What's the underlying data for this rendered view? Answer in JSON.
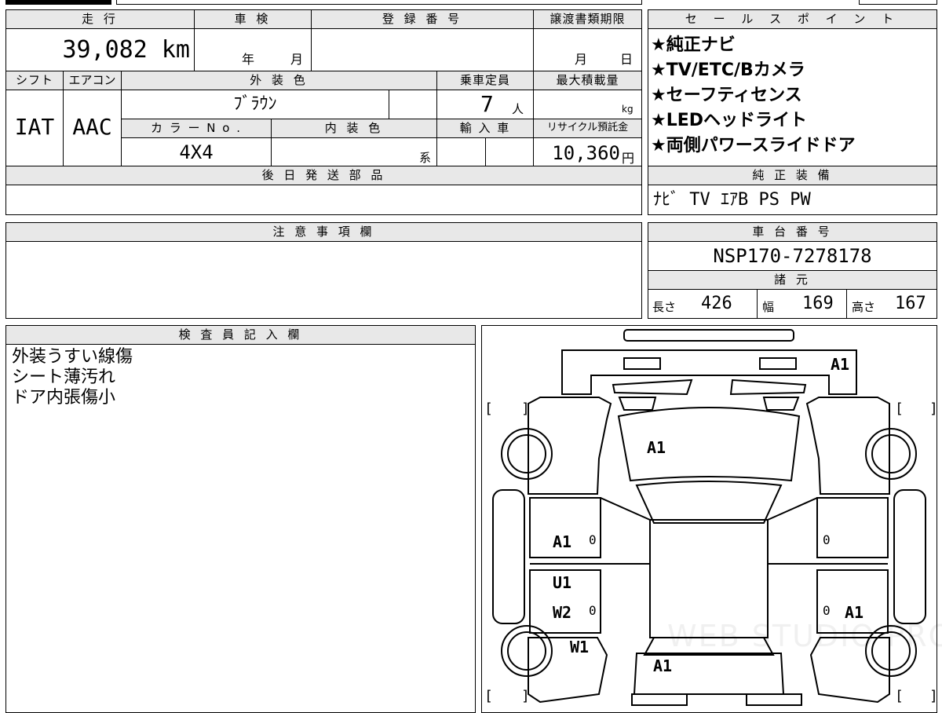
{
  "headers": {
    "mileage": "走 行",
    "inspection": "車 検",
    "registration": "登 録 番 号",
    "transfer_deadline": "譲渡書類期限",
    "shift": "シフト",
    "aircon": "エアコン",
    "exterior_color": "外 装 色",
    "capacity": "乗車定員",
    "max_load": "最大積載量",
    "color_no": "カ ラ ー N o .",
    "interior_color": "内 装 色",
    "import": "輸 入 車",
    "recycle": "リサイクル預託金",
    "later_parts": "後 日 発 送 部 品",
    "notes": "注 意 事 項 欄",
    "inspector": "検 査 員 記 入 欄",
    "sales_points": "セ ー ル ス ポ イ ン ト",
    "std_equipment": "純 正 装 備",
    "chassis": "車 台 番 号",
    "specs": "諸 元"
  },
  "vehicle": {
    "mileage": "39,082 km",
    "inspection_year": "年",
    "inspection_month": "月",
    "deadline_month": "月",
    "deadline_day": "日",
    "shift": "IAT",
    "aircon": "AAC",
    "exterior_color": "ﾌﾞﾗｳﾝ",
    "capacity": "7",
    "capacity_unit": "人",
    "load_unit": "kg",
    "color_no": "4X4",
    "interior_suffix": "系",
    "recycle_fee": "10,360",
    "recycle_unit": "円",
    "chassis_no": "NSP170-7278178",
    "length_label": "長さ",
    "length": "426",
    "width_label": "幅",
    "width": "169",
    "height_label": "高さ",
    "height": "167"
  },
  "sales_points": [
    "★純正ナビ",
    "★TV/ETC/Bカメラ",
    "★セーフティセンス",
    "★LEDヘッドライト",
    "★両側パワースライドドア"
  ],
  "std_equipment": "ﾅﾋﾞ TV ｴｱB PS PW",
  "inspector_notes": [
    "外装うすい線傷",
    "シート薄汚れ",
    "ドア内張傷小"
  ],
  "diagram": {
    "marks": [
      "A1",
      "A1",
      "A1",
      "0",
      "0",
      "U1",
      "W2",
      "0",
      "0",
      "A1",
      "W1",
      "A1"
    ],
    "brackets": [
      "[",
      "]",
      "[",
      "]",
      "[",
      "]",
      "[",
      "]"
    ],
    "watermark": "WEB STUDIO PRO"
  }
}
